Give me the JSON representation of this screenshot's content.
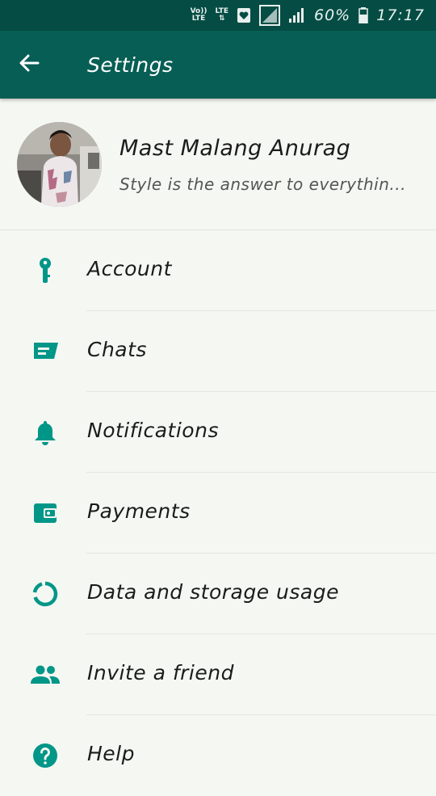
{
  "status_bar": {
    "volte": "Vo))",
    "lte_small": "LTE",
    "lte": "LTE",
    "battery": "60%",
    "time": "17:17"
  },
  "toolbar": {
    "title": "Settings"
  },
  "profile": {
    "name": "Mast Malang Anurag",
    "status": "Style is the answer to everythin..."
  },
  "menu": [
    {
      "label": "Account",
      "icon": "key-icon"
    },
    {
      "label": "Chats",
      "icon": "chat-icon"
    },
    {
      "label": "Notifications",
      "icon": "bell-icon"
    },
    {
      "label": "Payments",
      "icon": "wallet-icon"
    },
    {
      "label": "Data and storage usage",
      "icon": "data-usage-icon"
    },
    {
      "label": "Invite a friend",
      "icon": "people-icon"
    },
    {
      "label": "Help",
      "icon": "help-icon"
    }
  ],
  "colors": {
    "header": "#075e54",
    "statusbar": "#054d44",
    "accent": "#009688"
  }
}
